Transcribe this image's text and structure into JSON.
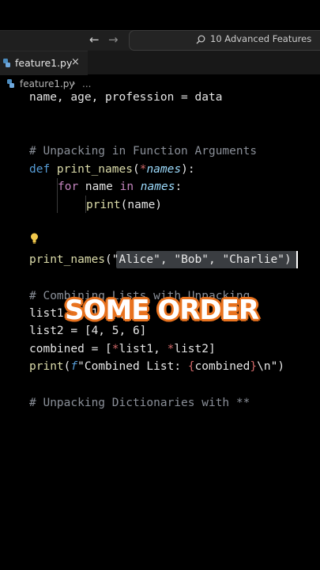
{
  "titlebar": {
    "back_icon": "arrow-left-icon",
    "forward_icon": "arrow-right-icon",
    "command_center_text": "10 Advanced Features"
  },
  "tab": {
    "label": "feature1.py",
    "close": "×"
  },
  "breadcrumb": {
    "file": "feature1.py",
    "separator": "›",
    "more": "..."
  },
  "code": {
    "l1": "name, age, profession = data",
    "c1": "# Unpacking in Function Arguments",
    "def_kw": "def",
    "def_name": " print_names",
    "def_open": "(",
    "def_star": "*",
    "def_param": "names",
    "def_close": "):",
    "for_kw": "for",
    "for_var": " name ",
    "in_kw": "in",
    "for_iter": "names",
    "for_colon": ":",
    "print_fn": "print",
    "print_args": "(name)",
    "call_fn": "print_names",
    "call_args_open": "(",
    "call_args": "\"Alice\", \"Bob\", \"Charlie\"",
    "call_args_close": ")",
    "c2": "# Combining Lists with Unpacking",
    "list1": "list1 = [1, 2, 3]",
    "list2": "list2 = [4, 5, 6]",
    "comb_a": "combined = [",
    "comb_star1": "*",
    "comb_b": "list1, ",
    "comb_star2": "*",
    "comb_c": "list2]",
    "pr_fn": "print",
    "pr_open": "(",
    "pr_f": "f",
    "pr_str1": "\"Combined List: ",
    "pr_lb": "{",
    "pr_var": "combined",
    "pr_rb": "}",
    "pr_str2": "\\n\"",
    "pr_close": ")",
    "c3": "# Unpacking Dictionaries with **"
  },
  "overlay_caption": "SOME ORDER",
  "colors": {
    "overlay_outline": "#e8721e",
    "keyword": "#569cd6",
    "function": "#dcdcaa"
  }
}
